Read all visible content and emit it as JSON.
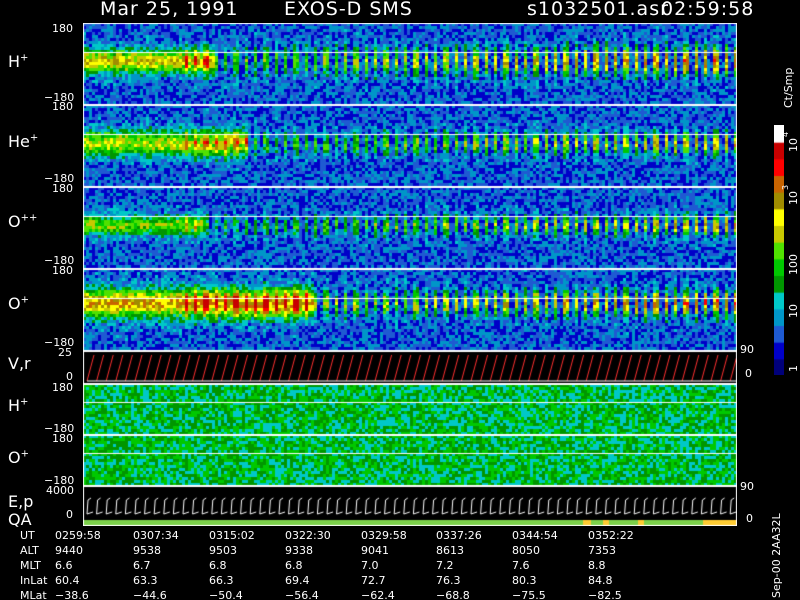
{
  "header": {
    "date": "Mar 25, 1991",
    "instrument": "EXOS-D SMS",
    "file": "s1032501.asr",
    "time": "02:59:58"
  },
  "colors": {
    "scale": [
      "#00007a",
      "#0000c8",
      "#1e5ad2",
      "#0096c8",
      "#00c8c8",
      "#009600",
      "#00c800",
      "#50e100",
      "#c8c800",
      "#ffff00",
      "#a08c00",
      "#c86400",
      "#ff0000",
      "#c80000",
      "#ffffff"
    ]
  },
  "colorbar": {
    "unit": "Ct/Smp",
    "tick_labels": [
      "1",
      "10",
      "100",
      "10",
      "3",
      "10",
      "4",
      "0"
    ],
    "levels": [
      1,
      10,
      100,
      1000,
      10000
    ]
  },
  "rotated_note": "Sep-00 2AA32L",
  "panels": [
    {
      "id": "h-plus",
      "label": "H",
      "sup": "+",
      "ytop": "180",
      "ybot": "−180"
    },
    {
      "id": "he-plus",
      "label": "He",
      "sup": "+",
      "ytop": "180",
      "ybot": "−180"
    },
    {
      "id": "o-plus-plus",
      "label": "O",
      "sup": "++",
      "ytop": "180",
      "ybot": "−180"
    },
    {
      "id": "o-plus",
      "label": "O",
      "sup": "+",
      "ytop": "180",
      "ybot": "−180"
    },
    {
      "id": "vr",
      "label": "V,r",
      "sup": "",
      "ytop": "25",
      "ybot": "0",
      "right": "90"
    },
    {
      "id": "h-plus-2",
      "label": "H",
      "sup": "+",
      "ytop": "180",
      "ybot": "−180"
    },
    {
      "id": "o-plus-2",
      "label": "O",
      "sup": "+",
      "ytop": "180",
      "ybot": "−180"
    },
    {
      "id": "ep",
      "label": "E,p",
      "sup": "",
      "ytop": "4000",
      "ybot": "0",
      "right": "90"
    }
  ],
  "qa_label": "QA",
  "qa_right": "0",
  "table": {
    "rows": [
      {
        "label": "UT",
        "values": [
          "0259:58",
          "0307:34",
          "0315:02",
          "0322:30",
          "0329:58",
          "0337:26",
          "0344:54",
          "0352:22"
        ]
      },
      {
        "label": "ALT",
        "values": [
          "9440",
          "9538",
          "9503",
          "9338",
          "9041",
          "8613",
          "8050",
          "7353"
        ]
      },
      {
        "label": "MLT",
        "values": [
          "6.6",
          "6.7",
          "6.8",
          "6.8",
          "7.0",
          "7.2",
          "7.6",
          "8.8"
        ]
      },
      {
        "label": "InLat",
        "values": [
          "60.4",
          "63.3",
          "66.3",
          "69.4",
          "72.7",
          "76.3",
          "80.3",
          "84.8"
        ]
      },
      {
        "label": "MLat",
        "values": [
          "−38.6",
          "−44.6",
          "−50.4",
          "−56.4",
          "−62.4",
          "−68.8",
          "−75.5",
          "−82.5"
        ]
      }
    ]
  },
  "chart_data": {
    "type": "heatmap",
    "title": "Mar 25, 1991   EXOS-D SMS",
    "xlabel": "UT",
    "x_ticks": [
      "0259:58",
      "0307:34",
      "0315:02",
      "0322:30",
      "0329:58",
      "0337:26",
      "0344:54",
      "0352:22"
    ],
    "series": [
      {
        "name": "H+",
        "ylim": [
          -180,
          180
        ],
        "color_scale": "log",
        "zlim": [
          1,
          10000
        ]
      },
      {
        "name": "He+",
        "ylim": [
          -180,
          180
        ],
        "color_scale": "log",
        "zlim": [
          1,
          10000
        ]
      },
      {
        "name": "O++",
        "ylim": [
          -180,
          180
        ],
        "color_scale": "log",
        "zlim": [
          1,
          10000
        ]
      },
      {
        "name": "O+",
        "ylim": [
          -180,
          180
        ],
        "color_scale": "log",
        "zlim": [
          1,
          10000
        ]
      },
      {
        "name": "V,r",
        "ylim": [
          0,
          25
        ],
        "right_label": "90"
      },
      {
        "name": "H+",
        "ylim": [
          -180,
          180
        ]
      },
      {
        "name": "O+",
        "ylim": [
          -180,
          180
        ]
      },
      {
        "name": "E,p",
        "ylim": [
          0,
          4000
        ],
        "right_label": "90"
      }
    ],
    "zunit": "Ct/Smp",
    "grid": false,
    "legend": "right"
  }
}
